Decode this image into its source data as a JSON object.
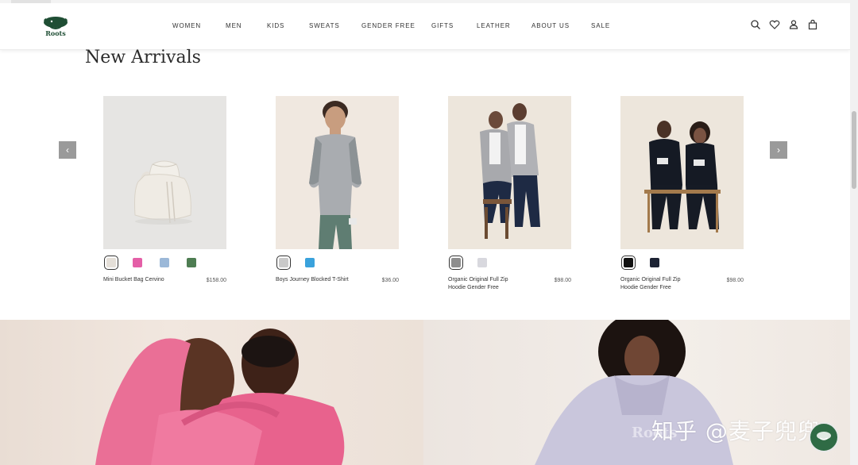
{
  "brand": {
    "name": "Roots"
  },
  "nav": [
    {
      "label": "WOMEN"
    },
    {
      "label": "MEN"
    },
    {
      "label": "KIDS"
    },
    {
      "label": "SWEATS"
    },
    {
      "label": "GENDER FREE"
    },
    {
      "label": "GIFTS"
    },
    {
      "label": "LEATHER"
    },
    {
      "label": "ABOUT US"
    },
    {
      "label": "SALE"
    }
  ],
  "header_icons": [
    "search-icon",
    "heart-icon",
    "account-icon",
    "bag-icon"
  ],
  "section": {
    "title": "New Arrivals"
  },
  "carousel": {
    "prev_icon": "‹",
    "next_icon": "›"
  },
  "products": [
    {
      "name": "Mini Bucket Bag Cervino",
      "price": "$158.00",
      "swatches": [
        "#e4dfd8",
        "#e45fa7",
        "#9bb8d8",
        "#4e7d52"
      ]
    },
    {
      "name": "Boys Journey Blocked T-Shirt",
      "price": "$36.00",
      "swatches": [
        "#c9c9c9",
        "#3aa2dc"
      ]
    },
    {
      "name": "Organic Original Full Zip Hoodie Gender Free",
      "price": "$98.00",
      "swatches": [
        "#8e8e8e",
        "#d8d8de"
      ]
    },
    {
      "name": "Organic Original Full Zip Hoodie Gender Free",
      "price": "$98.00",
      "swatches": [
        "#111111",
        "#1c2233"
      ]
    }
  ],
  "watermark": {
    "text": "知乎 @麦子兜兜"
  },
  "colors": {
    "brand_green": "#1f4e34",
    "hero_pink": "#e96b92",
    "hero_lavender": "#c9c6dc"
  }
}
